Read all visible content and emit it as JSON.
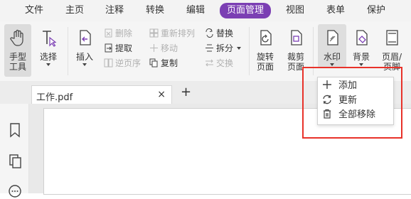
{
  "menu": [
    "文件",
    "主页",
    "注释",
    "转换",
    "编辑",
    "页面管理",
    "视图",
    "表单",
    "保护"
  ],
  "active_menu": "页面管理",
  "ribbon": {
    "hand_line1": "手型",
    "hand_line2": "工具",
    "select": "选择",
    "insert": "插入",
    "delete": "删除",
    "extract": "提取",
    "reverse": "逆页序",
    "reorder": "重新排列",
    "move": "移动",
    "copy": "复制",
    "replace": "替换",
    "split": "拆分",
    "swap": "交换",
    "rotate_line1": "旋转",
    "rotate_line2": "页面",
    "crop_line1": "裁剪",
    "crop_line2": "页面",
    "watermark": "水印",
    "background": "背景",
    "header_line1": "页眉/",
    "header_line2": "页脚"
  },
  "tab": {
    "label": "工作.pdf",
    "close": "×",
    "new": "+"
  },
  "watermark_menu": [
    "添加",
    "更新",
    "全部移除"
  ],
  "colors": {
    "accent": "#7b3fb3",
    "highlight": "#e8322a"
  }
}
